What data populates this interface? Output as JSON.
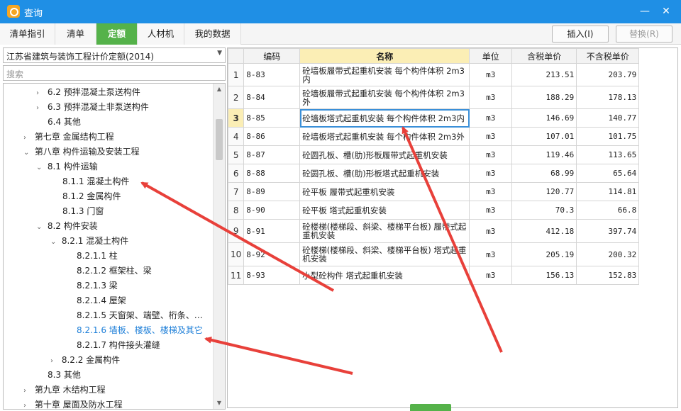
{
  "window": {
    "title": "查询",
    "minimize": "—",
    "close": "✕"
  },
  "tabs": [
    {
      "label": "清单指引"
    },
    {
      "label": "清单"
    },
    {
      "label": "定额"
    },
    {
      "label": "人材机"
    },
    {
      "label": "我的数据"
    }
  ],
  "toolbar": {
    "insert_label": "插入(I)",
    "replace_label": "替换(R)"
  },
  "left": {
    "dropdown_value": "江苏省建筑与装饰工程计价定额(2014)",
    "search_placeholder": "搜索",
    "tree": [
      {
        "label": "6.2 预拌混凝土泵送构件"
      },
      {
        "label": "6.3 预拌混凝土非泵送构件"
      },
      {
        "label": "6.4 其他"
      },
      {
        "label": "第七章 金属结构工程"
      },
      {
        "label": "第八章 构件运输及安装工程"
      },
      {
        "label": "8.1 构件运输"
      },
      {
        "label": "8.1.1 混凝土构件"
      },
      {
        "label": "8.1.2 金属构件"
      },
      {
        "label": "8.1.3 门窗"
      },
      {
        "label": "8.2 构件安装"
      },
      {
        "label": "8.2.1 混凝土构件"
      },
      {
        "label": "8.2.1.1 柱"
      },
      {
        "label": "8.2.1.2 框架柱、梁"
      },
      {
        "label": "8.2.1.3 梁"
      },
      {
        "label": "8.2.1.4 屋架"
      },
      {
        "label": "8.2.1.5 天窗架、端壁、桁条、…"
      },
      {
        "label": "8.2.1.6 墙板、楼板、楼梯及其它"
      },
      {
        "label": "8.2.1.7 构件接头灌缝"
      },
      {
        "label": "8.2.2 金属构件"
      },
      {
        "label": "8.3 其他"
      },
      {
        "label": "第九章 木结构工程"
      },
      {
        "label": "第十章 屋面及防水工程"
      }
    ]
  },
  "table": {
    "headers": {
      "idx": "",
      "code": "编码",
      "name": "名称",
      "unit": "单位",
      "tax_price": "含税单价",
      "notax_price": "不含税单价"
    },
    "rows": [
      {
        "idx": "1",
        "code": "8-83",
        "name": "砼墙板履带式起重机安装 每个构件体积 2m3内",
        "unit": "m3",
        "tax_price": "213.51",
        "notax_price": "203.79"
      },
      {
        "idx": "2",
        "code": "8-84",
        "name": "砼墙板履带式起重机安装 每个构件体积 2m3外",
        "unit": "m3",
        "tax_price": "188.29",
        "notax_price": "178.13"
      },
      {
        "idx": "3",
        "code": "8-85",
        "name": "砼墙板塔式起重机安装 每个构件体积 2m3内",
        "unit": "m3",
        "tax_price": "146.69",
        "notax_price": "140.77"
      },
      {
        "idx": "4",
        "code": "8-86",
        "name": "砼墙板塔式起重机安装 每个构件体积 2m3外",
        "unit": "m3",
        "tax_price": "107.01",
        "notax_price": "101.75"
      },
      {
        "idx": "5",
        "code": "8-87",
        "name": "砼圆孔板、槽(肋)形板履带式起重机安装",
        "unit": "m3",
        "tax_price": "119.46",
        "notax_price": "113.65"
      },
      {
        "idx": "6",
        "code": "8-88",
        "name": "砼圆孔板、槽(肋)形板塔式起重机安装",
        "unit": "m3",
        "tax_price": "68.99",
        "notax_price": "65.64"
      },
      {
        "idx": "7",
        "code": "8-89",
        "name": "砼平板 履带式起重机安装",
        "unit": "m3",
        "tax_price": "120.77",
        "notax_price": "114.81"
      },
      {
        "idx": "8",
        "code": "8-90",
        "name": "砼平板 塔式起重机安装",
        "unit": "m3",
        "tax_price": "70.3",
        "notax_price": "66.8"
      },
      {
        "idx": "9",
        "code": "8-91",
        "name": "砼楼梯(楼梯段、斜梁、楼梯平台板) 履带式起重机安装",
        "unit": "m3",
        "tax_price": "412.18",
        "notax_price": "397.74"
      },
      {
        "idx": "10",
        "code": "8-92",
        "name": "砼楼梯(楼梯段、斜梁、楼梯平台板) 塔式起重机安装",
        "unit": "m3",
        "tax_price": "205.19",
        "notax_price": "200.32"
      },
      {
        "idx": "11",
        "code": "8-93",
        "name": "小型砼构件 塔式起重机安装",
        "unit": "m3",
        "tax_price": "156.13",
        "notax_price": "152.83"
      }
    ]
  },
  "colors": {
    "titlebar": "#1f8fe5",
    "active_tab": "#55b24a",
    "header_highlight": "#fbeeb5",
    "selected_tree_item": "#1e7fd8",
    "annotation_arrow": "#e8403a"
  }
}
